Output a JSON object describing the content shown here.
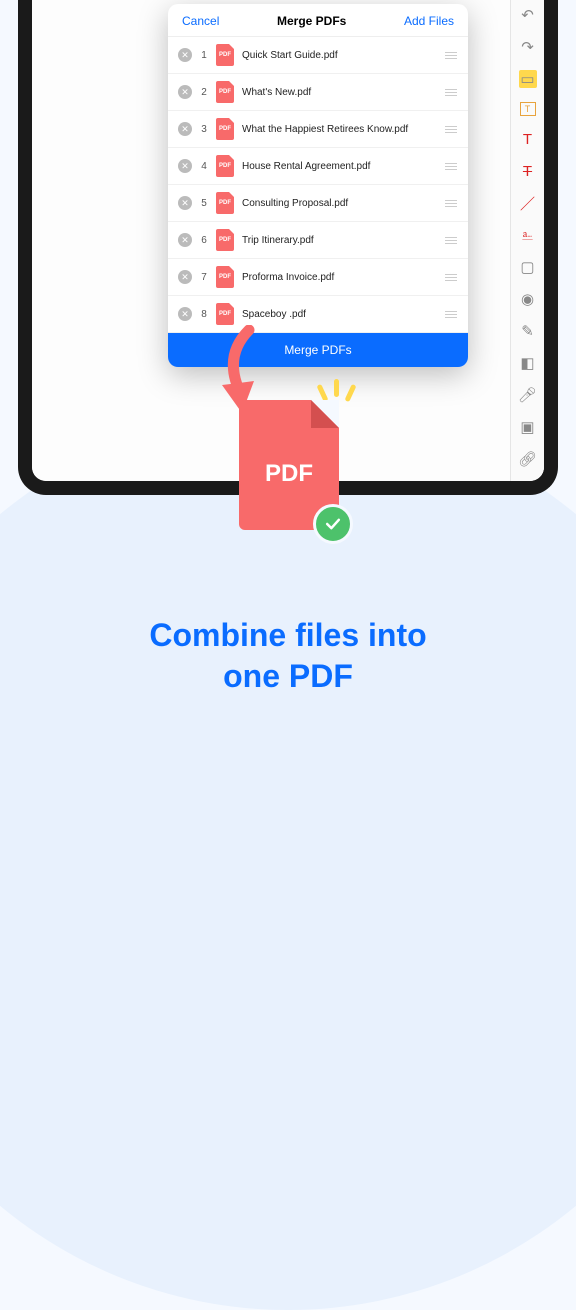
{
  "dialog": {
    "cancel": "Cancel",
    "title": "Merge PDFs",
    "add": "Add Files",
    "merge_button": "Merge PDFs",
    "files": [
      {
        "num": "1",
        "badge": "PDF",
        "name": "Quick Start Guide.pdf"
      },
      {
        "num": "2",
        "badge": "PDF",
        "name": "What's New.pdf"
      },
      {
        "num": "3",
        "badge": "PDF",
        "name": "What the Happiest Retirees Know.pdf"
      },
      {
        "num": "4",
        "badge": "PDF",
        "name": "House Rental Agreement.pdf"
      },
      {
        "num": "5",
        "badge": "PDF",
        "name": "Consulting Proposal.pdf"
      },
      {
        "num": "6",
        "badge": "PDF",
        "name": "Trip Itinerary.pdf"
      },
      {
        "num": "7",
        "badge": "PDF",
        "name": "Proforma Invoice.pdf"
      },
      {
        "num": "8",
        "badge": "PDF",
        "name": "Spaceboy .pdf"
      }
    ]
  },
  "big_pdf_label": "PDF",
  "tagline_line1": "Combine files into",
  "tagline_line2": "one PDF"
}
